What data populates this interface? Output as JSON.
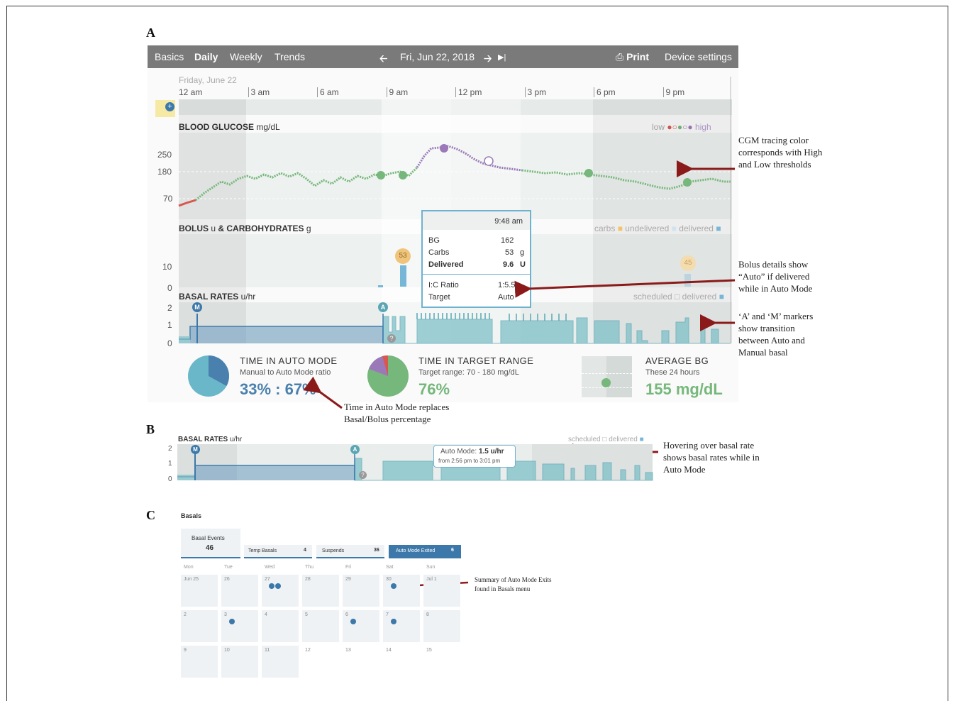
{
  "figure": {
    "panel_a": "A",
    "panel_b": "B",
    "panel_c": "C"
  },
  "nav": {
    "tabs": [
      "Basics",
      "Daily",
      "Weekly",
      "Trends"
    ],
    "date": "Fri, Jun 22, 2018",
    "print_label": "Print",
    "device_settings": "Device settings"
  },
  "daily": {
    "day_label": "Friday, June 22",
    "time_ticks": [
      "12 am",
      "3 am",
      "6 am",
      "9 am",
      "12 pm",
      "3 pm",
      "6 pm",
      "9 pm"
    ],
    "bg": {
      "title": "BLOOD GLUCOSE",
      "unit": "mg/dL",
      "legend_low": "low",
      "legend_high": "high",
      "ticks": [
        "250",
        "180",
        "70"
      ],
      "colors": {
        "low": "#d9574f",
        "target": "#76b77b",
        "high": "#9b79b9"
      }
    },
    "bolus": {
      "title": "BOLUS",
      "unit_u": "u",
      "amp": "&",
      "carbs_title": "CARBOHYDRATES",
      "unit_g": "g",
      "legend": "carbs",
      "legend_undelivered": "undelivered",
      "legend_delivered": "delivered",
      "ticks": [
        "10",
        "0"
      ],
      "carb_values": [
        "53",
        "45"
      ]
    },
    "basal": {
      "title": "BASAL RATES",
      "unit": "u/hr",
      "legend_scheduled": "scheduled",
      "legend_delivered": "delivered",
      "ticks": [
        "2",
        "1",
        "0"
      ],
      "marker_m": "M",
      "marker_a": "A",
      "marker_q": "?"
    },
    "tooltip": {
      "time": "9:48 am",
      "bg_label": "BG",
      "bg_value": "162",
      "carbs_label": "Carbs",
      "carbs_value": "53",
      "carbs_unit": "g",
      "delivered_label": "Delivered",
      "delivered_value": "9.6",
      "delivered_unit": "U",
      "ic_label": "I:C Ratio",
      "ic_value": "1:5.5",
      "target_label": "Target",
      "target_value": "Auto"
    },
    "stats": {
      "auto_title": "TIME IN AUTO MODE",
      "auto_sub": "Manual to Auto Mode ratio",
      "auto_value": "33% : 67%",
      "auto_manual_fraction": 0.33,
      "target_title": "TIME IN TARGET RANGE",
      "target_sub": "Target range: 70 - 180 mg/dL",
      "target_value": "76%",
      "avg_title": "AVERAGE BG",
      "avg_sub": "These 24 hours",
      "avg_value": "155 mg/dL"
    }
  },
  "annotations": {
    "cgm": "CGM tracing color corresponds with High and Low thresholds",
    "bolus": "Bolus details show “Auto” if delivered while in Auto Mode",
    "markers": "‘A’ and ‘M’ markers show transition between Auto and Manual basal",
    "auto_time": "Time in Auto Mode replaces Basal/Bolus percentage",
    "hover": "Hovering over basal rate shows basal rates while in Auto Mode",
    "summary": "Summary of Auto Mode Exits found in Basals menu"
  },
  "panel_b": {
    "title": "BASAL RATES",
    "unit": "u/hr",
    "legend_scheduled": "scheduled",
    "legend_delivered": "delivered",
    "ticks": [
      "2",
      "1",
      "0"
    ],
    "tooltip_mode": "Auto Mode:",
    "tooltip_rate": "1.5 u/hr",
    "tooltip_range": "from 2:56 pm to 3:01 pm"
  },
  "panel_c": {
    "title": "Basals",
    "tabs": [
      {
        "label": "Basal Events",
        "count": "46"
      },
      {
        "label": "Temp Basals",
        "count": "4"
      },
      {
        "label": "Suspends",
        "count": "36"
      },
      {
        "label": "Auto Mode Exited",
        "count": "6"
      }
    ],
    "weekdays": [
      "Mon",
      "Tue",
      "Wed",
      "Thu",
      "Fri",
      "Sat",
      "Sun"
    ],
    "weeks": [
      [
        {
          "d": "Jun 25",
          "n": 0
        },
        {
          "d": "26",
          "n": 0
        },
        {
          "d": "27",
          "n": 2
        },
        {
          "d": "28",
          "n": 0
        },
        {
          "d": "29",
          "n": 0
        },
        {
          "d": "30",
          "n": 1
        },
        {
          "d": "Jul 1",
          "n": 0
        }
      ],
      [
        {
          "d": "2",
          "n": 0
        },
        {
          "d": "3",
          "n": 1
        },
        {
          "d": "4",
          "n": 0
        },
        {
          "d": "5",
          "n": 0
        },
        {
          "d": "6",
          "n": 1
        },
        {
          "d": "7",
          "n": 1
        },
        {
          "d": "8",
          "n": 0
        }
      ],
      [
        {
          "d": "9",
          "n": 0
        },
        {
          "d": "10",
          "n": 0
        },
        {
          "d": "11",
          "n": 0
        },
        {
          "d": "12",
          "n": 0
        },
        {
          "d": "13",
          "n": 0
        },
        {
          "d": "14",
          "n": 0
        },
        {
          "d": "15",
          "n": 0
        }
      ]
    ]
  }
}
